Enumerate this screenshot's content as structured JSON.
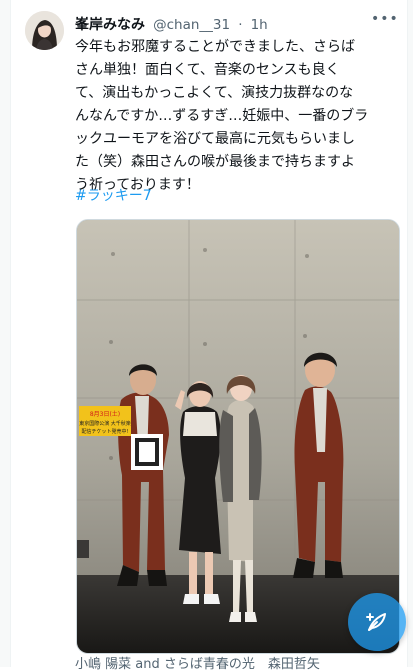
{
  "tweet": {
    "display_name": "峯岸みなみ",
    "handle": "@chan__31",
    "separator": "·",
    "time": "1h",
    "more_label": "•••",
    "text": "今年もお邪魔することができました、さらば\nさん単独！面白くて、音楽のセンスも良く\nて、演出もかっこよくて、演技力抜群なのな\nんなんですか…ずるすぎ…妊娠中、一番のブラ\nックユーモアを浴びて最高に元気もらいまし\nた（笑）森田さんの喉が最後まで持ちますよ\nう祈っております！",
    "hashtag": "#ラッキー7"
  },
  "media": {
    "poster_text_line1": "8月3日(土)",
    "poster_text_line2": "東京国際公演 大千秋楽",
    "poster_text_line3": "配信チケット発売中!",
    "caption": "小嶋 陽菜 and さらば青春の光　森田哲矢"
  },
  "icons": {
    "more": "more-dots-icon",
    "compose": "compose-feather-icon"
  },
  "colors": {
    "link": "#1d9bf0",
    "secondary_text": "#536471",
    "compose_button": "#1d9bf0"
  }
}
